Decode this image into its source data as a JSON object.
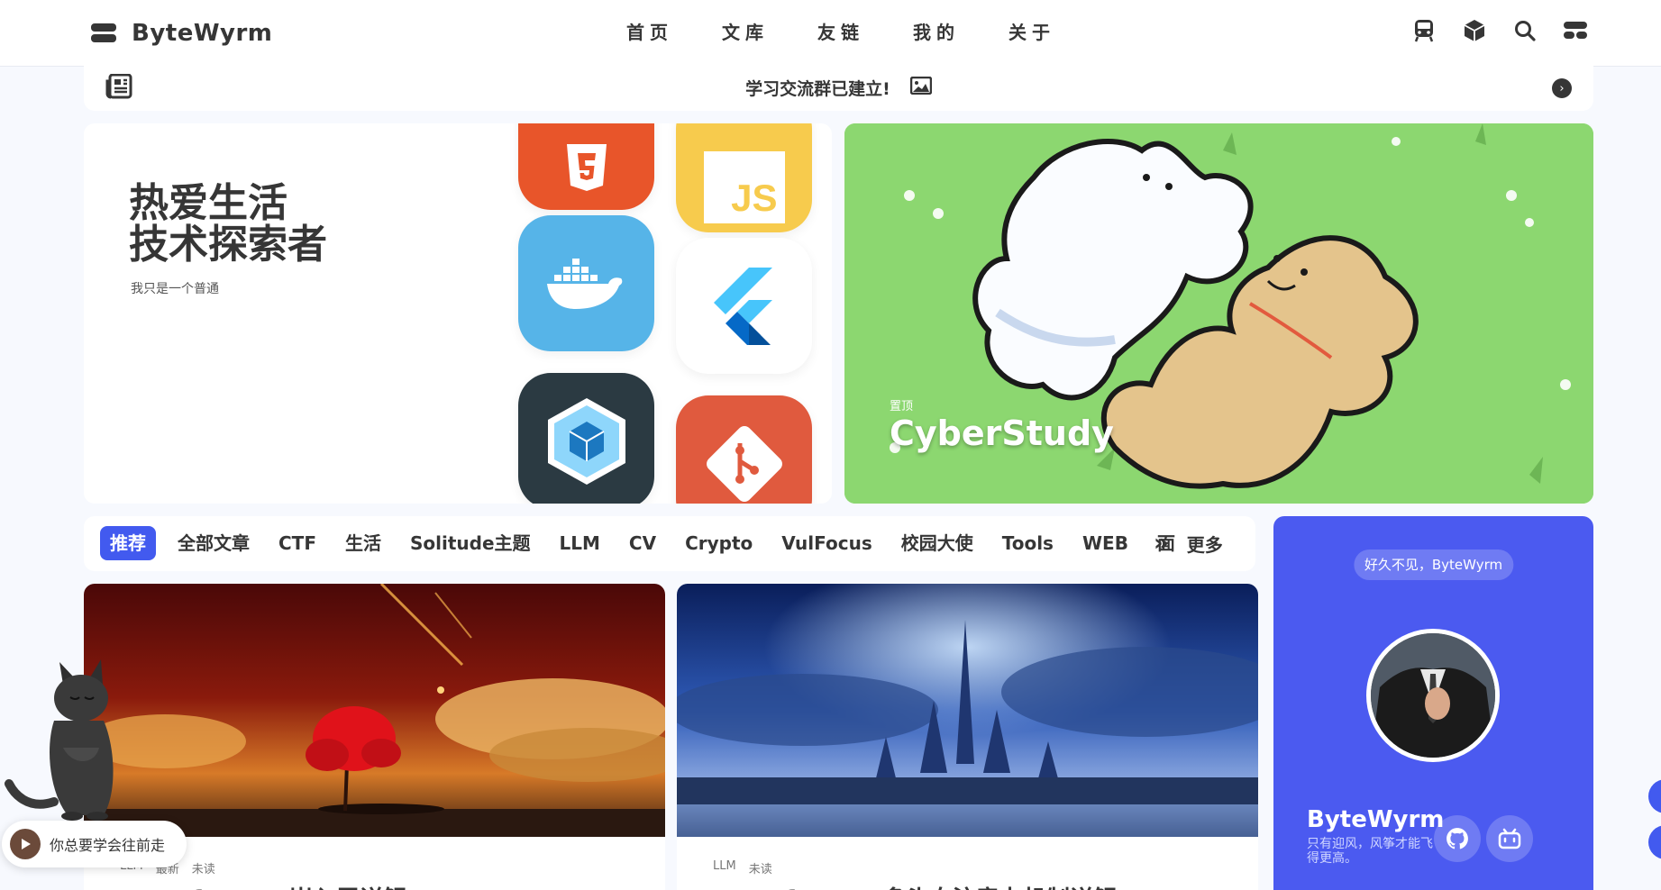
{
  "nav": {
    "site_name": "ByteWyrm",
    "menu": [
      "首页",
      "文库",
      "友链",
      "我的",
      "关于"
    ],
    "icons": [
      "train-icon",
      "cube-icon",
      "search-icon",
      "toggle-icon"
    ]
  },
  "notice": {
    "text": "学习交流群已建立!"
  },
  "hero": {
    "slogan_line1": "热爱生活",
    "slogan_line2": "技术探索者",
    "subtitle": "我只是一个普通",
    "tiles": [
      "html5-icon",
      "js-icon",
      "docker-icon",
      "flutter-icon",
      "webpack-icon",
      "git-icon"
    ],
    "js_label": "JS",
    "feature_tag": "置顶",
    "feature_title": "CyberStudy"
  },
  "categories": {
    "items": [
      "推荐",
      "全部文章",
      "CTF",
      "生活",
      "Solitude主题",
      "LLM",
      "CV",
      "Crypto",
      "VulFocus",
      "校园大使",
      "Tools",
      "WEB",
      "面"
    ],
    "more": "更多"
  },
  "articles": [
    {
      "meta": [
        "LLM",
        "最新",
        "未读"
      ],
      "title": "Transformer 嵌入层详解"
    },
    {
      "meta": [
        "LLM",
        "未读"
      ],
      "title": "Transformer 多头自注意力机制详解"
    }
  ],
  "profile": {
    "greeting": "好久不见，ByteWyrm",
    "name": "ByteWyrm",
    "desc": "只有迎风，风筝才能飞得更高。"
  },
  "player": {
    "text": "你总要学会往前走"
  },
  "colors": {
    "accent": "#425aef",
    "profile_bg": "#4b5af0",
    "text": "#363636",
    "page_bg": "#f7f9fe"
  }
}
